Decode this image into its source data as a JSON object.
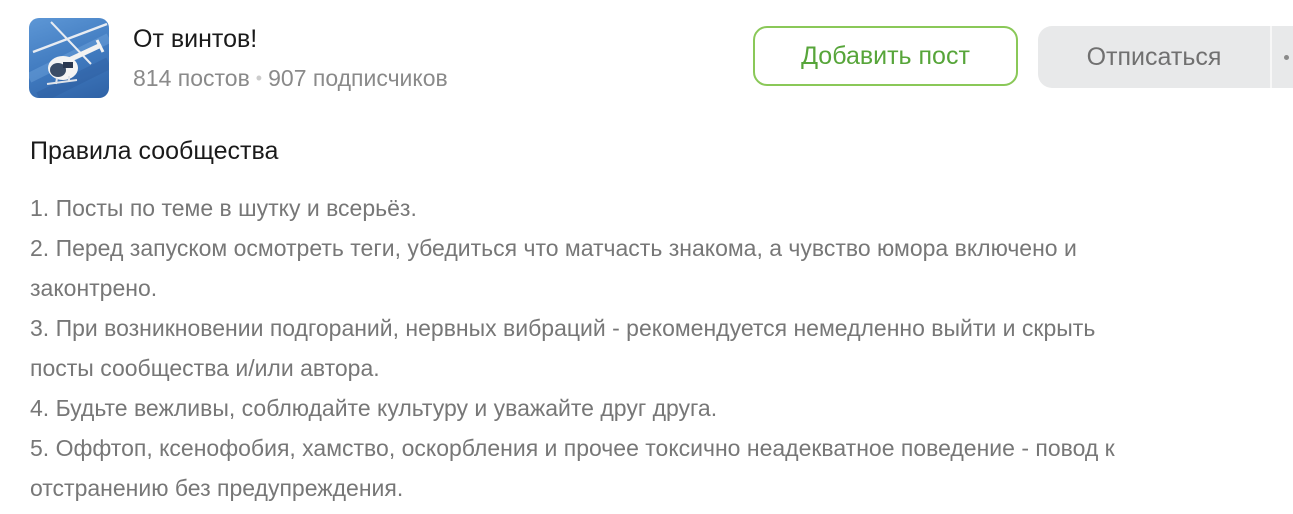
{
  "community": {
    "title": "От винтов!",
    "posts": "814 постов",
    "separator": "•",
    "subscribers": "907 подписчиков",
    "avatar_icon": "helicopter-icon"
  },
  "actions": {
    "add_post": "Добавить пост",
    "unsubscribe": "Отписаться",
    "more_icon": "more-dots-icon"
  },
  "rules": {
    "heading": "Правила сообщества",
    "lines": [
      "1. Посты по теме в шутку и всерьёз.",
      "2. Перед запуском осмотреть теги, убедиться что матчасть знакома, а чувство юмора включено и",
      "законтрено.",
      "3. При возникновении подгораний, нервных вибраций - рекомендуется немедленно выйти и скрыть",
      "посты сообщества и/или автора.",
      "4. Будьте вежливы, соблюдайте культуру и уважайте друг друга.",
      "5. Оффтоп, ксенофобия, хамство, оскорбления и прочее токсично неадекватное поведение - повод к",
      "отстранению без предупреждения."
    ]
  },
  "colors": {
    "accent_green": "#57a53a",
    "button_border": "#8ac858",
    "button_gray": "#e8e9ea",
    "text_muted": "#777777"
  }
}
